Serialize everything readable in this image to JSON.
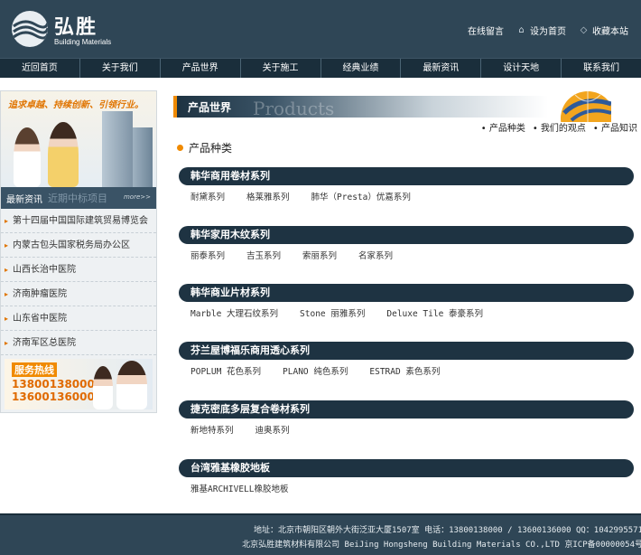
{
  "header": {
    "logo_cn": "弘胜",
    "logo_en": "Building Materials",
    "top_links": [
      "在线留言",
      "设为首页",
      "收藏本站"
    ]
  },
  "nav": [
    "近回首页",
    "关于我们",
    "产品世界",
    "关于施工",
    "经典业绩",
    "最新资讯",
    "设计天地",
    "联系我们"
  ],
  "sidebar": {
    "banner_slogan": "追求卓越、持续创新、引领行业。",
    "title_active": "最新资讯",
    "title_inactive": "近期中标项目",
    "more": "more>>",
    "items": [
      "第十四届中国国际建筑贸易博览会",
      "内蒙古包头国家税务局办公区",
      "山西长治中医院",
      "济南肿瘤医院",
      "山东省中医院",
      "济南军区总医院"
    ],
    "hotline_title": "服务热线",
    "hotline_numbers": [
      "13800138000",
      "13600136000"
    ]
  },
  "main": {
    "title": "产品世界",
    "ghost_title": "Products",
    "sub_links": [
      "产品种类",
      "我们的观点",
      "产品知识"
    ],
    "section_title": "产品种类",
    "categories": [
      {
        "name": "韩华商用卷材系列",
        "items": [
          "耐黛系列",
          "格莱雅系列",
          "肺华（Presta）优嘉系列"
        ]
      },
      {
        "name": "韩华家用木纹系列",
        "items": [
          "丽泰系列",
          "吉玉系列",
          "索丽系列",
          "名家系列"
        ]
      },
      {
        "name": "韩华商业片材系列",
        "items": [
          "Marble 大理石纹系列",
          "Stone 丽雅系列",
          "Deluxe Tile 泰豪系列"
        ]
      },
      {
        "name": "芬兰屋博福乐商用透心系列",
        "items": [
          "POPLUM 花色系列",
          "PLANO 纯色系列",
          "ESTRAD 素色系列"
        ]
      },
      {
        "name": "捷克密底多层复合卷材系列",
        "items": [
          "新地特系列",
          "迪奥系列"
        ]
      },
      {
        "name": "台湾雅基橡胶地板",
        "items": [
          "雅基ARCHIVELL橡胶地板"
        ]
      }
    ]
  },
  "footer": {
    "line1": "地址：北京市朝阳区朝外大街泛亚大厦1507室 电话：13800138000 / 13600136000 QQ：1042995571",
    "line2": "北京弘胜建筑材料有限公司 BeiJing Hongsheng Building Materials CO.,LTD 京ICP备00000054号"
  },
  "colors": {
    "header_bg": "#2f4656",
    "nav_bg": "#1a2e3b",
    "accent": "#f08a00",
    "category_bar": "#1e3342"
  }
}
